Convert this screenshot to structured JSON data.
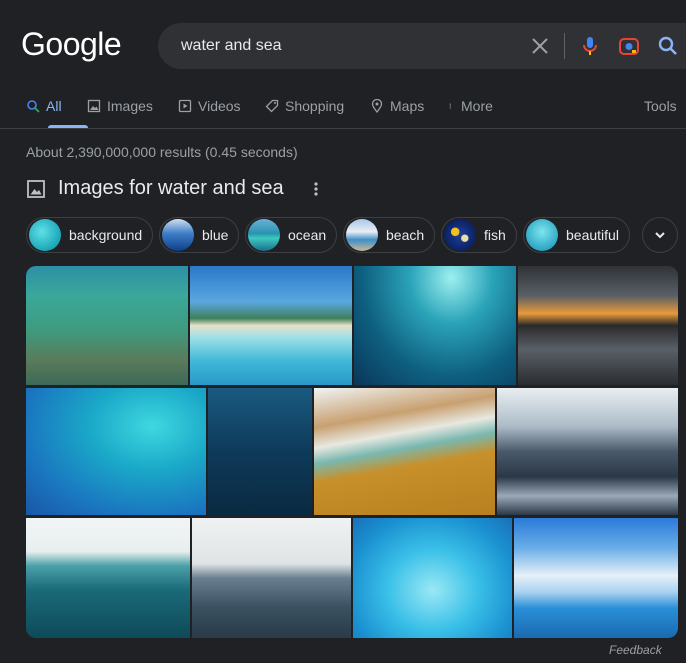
{
  "logo": "Google",
  "search": {
    "query": "water and sea"
  },
  "tabs": [
    {
      "label": "All",
      "icon": "search-icon",
      "active": true
    },
    {
      "label": "Images",
      "icon": "image-icon"
    },
    {
      "label": "Videos",
      "icon": "play-icon"
    },
    {
      "label": "Shopping",
      "icon": "tag-icon"
    },
    {
      "label": "Maps",
      "icon": "location-pin-icon"
    },
    {
      "label": "More",
      "icon": "more-vertical-icon"
    }
  ],
  "tools_label": "Tools",
  "result_stats": "About 2,390,000,000 results (0.45 seconds)",
  "images_section": {
    "title": "Images for water and sea"
  },
  "chips": [
    {
      "label": "background"
    },
    {
      "label": "blue"
    },
    {
      "label": "ocean"
    },
    {
      "label": "beach"
    },
    {
      "label": "fish"
    },
    {
      "label": "beautiful"
    }
  ],
  "colors": {
    "background": "#202124",
    "searchbox": "#303134",
    "accent": "#8ab4f8",
    "text": "#e8eaed",
    "muted": "#9aa0a6"
  },
  "feedback_label": "Feedback"
}
